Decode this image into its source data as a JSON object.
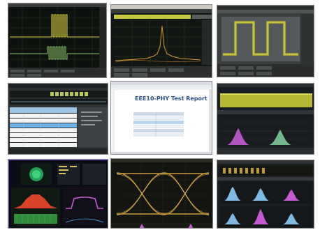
{
  "report": {
    "title": "EEE10-PHY Test Report",
    "subtitle": "",
    "footer": ""
  },
  "colors": {
    "scope_background": "#111511",
    "trace_yellow": "#d8d040",
    "trace_green": "#8fc46a",
    "trace_orange": "#d89a3a",
    "trace_magenta": "#c45ad0",
    "panel_grey": "#5a5e62",
    "report_blue": "#2b4f86"
  },
  "tiles": [
    {
      "name": "burst-waveform"
    },
    {
      "name": "spectrum-view"
    },
    {
      "name": "square-wave-view"
    },
    {
      "name": "protocol-decode-table"
    },
    {
      "name": "test-report-document"
    },
    {
      "name": "histogram-view"
    },
    {
      "name": "signal-analysis-dashboard"
    },
    {
      "name": "eye-diagram"
    },
    {
      "name": "multi-histogram-view"
    }
  ]
}
